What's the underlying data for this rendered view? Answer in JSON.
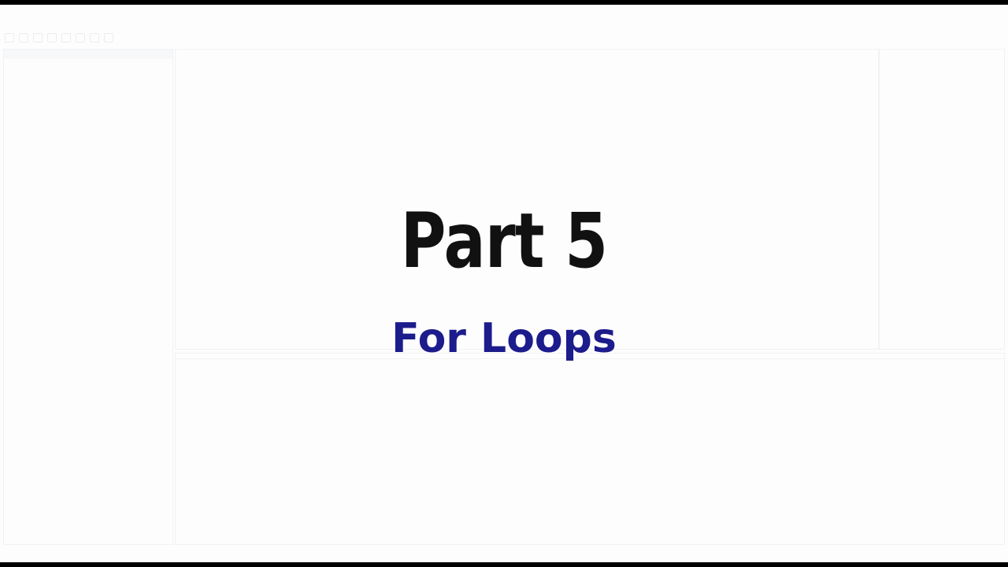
{
  "overlay": {
    "title": "Part 5",
    "subtitle": "For Loops",
    "title_color": "#111111",
    "subtitle_color": "#1c1c8c"
  },
  "colors": {
    "frame_background": "#fdfdfd",
    "letterbox": "#000000"
  }
}
